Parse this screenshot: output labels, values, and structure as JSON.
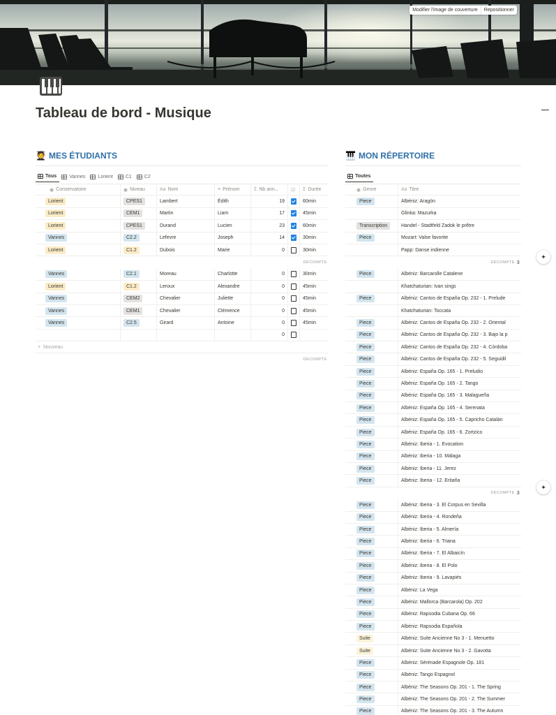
{
  "cover": {
    "change_label": "Modifier l'image de couverture",
    "reposition_label": "Repositionner"
  },
  "page": {
    "icon": "piano-keys-icon",
    "title": "Tableau de bord - Musique"
  },
  "students": {
    "emoji": "🧑‍🎓",
    "title": "MES ÉTUDIANTS",
    "tabs": [
      "Tous",
      "Vannes",
      "Lorient",
      "C1",
      "C2"
    ],
    "columns": [
      "Conservatoire",
      "Niveau",
      "Nom",
      "Prénom",
      "Nb ann...",
      "",
      "Durée"
    ],
    "groups": [
      {
        "rows": [
          {
            "conservatoire": "Lorient",
            "niveau": "CPES1",
            "nom": "Lambert",
            "prenom": "Édith",
            "nb": "19",
            "checked": true,
            "duree": "60min"
          },
          {
            "conservatoire": "Lorient",
            "niveau": "CEM1",
            "nom": "Martin",
            "prenom": "Liam",
            "nb": "17",
            "checked": true,
            "duree": "45min"
          },
          {
            "conservatoire": "Lorient",
            "niveau": "CPES1",
            "nom": "Durand",
            "prenom": "Lucien",
            "nb": "23",
            "checked": true,
            "duree": "60min"
          },
          {
            "conservatoire": "Vannes",
            "niveau": "C2.2",
            "nom": "Lefevre",
            "prenom": "Joseph",
            "nb": "14",
            "checked": true,
            "duree": "30min"
          },
          {
            "conservatoire": "Lorient",
            "niveau": "C1.2",
            "nom": "Dubois",
            "prenom": "Marie",
            "nb": "0",
            "checked": false,
            "duree": "30min"
          }
        ],
        "count_label": "DÉCOMPTE",
        "count_value": ""
      },
      {
        "rows": [
          {
            "conservatoire": "Vannes",
            "niveau": "C2.1",
            "nom": "Moreau",
            "prenom": "Charlotte",
            "nb": "0",
            "checked": false,
            "duree": "30min"
          },
          {
            "conservatoire": "Lorient",
            "niveau": "C1.2",
            "nom": "Leroux",
            "prenom": "Alexandre",
            "nb": "0",
            "checked": false,
            "duree": "45min"
          },
          {
            "conservatoire": "Vannes",
            "niveau": "CEM2",
            "nom": "Chevalier",
            "prenom": "Juliette",
            "nb": "0",
            "checked": false,
            "duree": "45min"
          },
          {
            "conservatoire": "Vannes",
            "niveau": "CEM1",
            "nom": "Chevalier",
            "prenom": "Clémence",
            "nb": "0",
            "checked": false,
            "duree": "45min"
          },
          {
            "conservatoire": "Vannes",
            "niveau": "C2.5",
            "nom": "Girard",
            "prenom": "Antoine",
            "nb": "0",
            "checked": false,
            "duree": "45min"
          },
          {
            "conservatoire": "",
            "niveau": "",
            "nom": "",
            "prenom": "",
            "nb": "0",
            "checked": false,
            "duree": ""
          }
        ],
        "new_label": "Nouveau",
        "count_label": "DÉCOMPTE",
        "count_value": ""
      }
    ]
  },
  "repertoire": {
    "emoji": "🎹",
    "title": "MON RÉPERTOIRE",
    "tabs": [
      "Toutes"
    ],
    "columns": [
      "Genre",
      "Titre"
    ],
    "groups": [
      {
        "rows": [
          {
            "genre": "Piece",
            "titre": "Albéniz: Aragòn"
          },
          {
            "genre": "",
            "titre": "Glinka: Mazurka"
          },
          {
            "genre": "Transcription",
            "titre": "Handel - Stadtfeld Zadok le prêtre"
          },
          {
            "genre": "Piece",
            "titre": "Mozart: Valse favorite"
          },
          {
            "genre": "",
            "titre": "Papp: Danse indienne"
          }
        ],
        "count_label": "DÉCOMPTE",
        "count_value": "3"
      },
      {
        "rows": [
          {
            "genre": "Piece",
            "titre": "Albéniz: Barcarolle Catalene"
          },
          {
            "genre": "",
            "titre": "Khatchaturian: Ivan sings"
          },
          {
            "genre": "Piece",
            "titre": "Albéniz: Cantos de España Op. 232 - 1. Prelude"
          },
          {
            "genre": "",
            "titre": "Khatchaturian: Toccata"
          },
          {
            "genre": "Piece",
            "titre": "Albéniz: Cantos de España Op. 232 - 2. Oriental"
          },
          {
            "genre": "Piece",
            "titre": "Albéniz: Cantos de España Op. 232 - 3. Bajo la p"
          },
          {
            "genre": "Piece",
            "titre": "Albéniz: Cantos de España Op. 232 - 4. Córdoba"
          },
          {
            "genre": "Piece",
            "titre": "Albéniz: Cantos de España Op. 232 - 5. Seguidil"
          },
          {
            "genre": "Piece",
            "titre": "Albéniz: España Op. 165 - 1. Preludio"
          },
          {
            "genre": "Piece",
            "titre": "Albéniz: España Op. 165 - 2. Tango"
          },
          {
            "genre": "Piece",
            "titre": "Albéniz: España Op. 165 - 3. Malagueña"
          },
          {
            "genre": "Piece",
            "titre": "Albéniz: España Op. 165 - 4. Serenata"
          },
          {
            "genre": "Piece",
            "titre": "Albéniz: España Op. 165 - 5. Capricho Catalán"
          },
          {
            "genre": "Piece",
            "titre": "Albéniz: España Op. 165 - 6. Zortzico"
          },
          {
            "genre": "Piece",
            "titre": "Albéniz: Iberia - 1. Evocation"
          },
          {
            "genre": "Piece",
            "titre": "Albéniz: Iberia - 10. Málaga"
          },
          {
            "genre": "Piece",
            "titre": "Albéniz: Iberia - 11. Jerez"
          },
          {
            "genre": "Piece",
            "titre": "Albéniz: Iberia - 12. Eritaña"
          }
        ],
        "count_label": "DÉCOMPTE",
        "count_value": "3"
      },
      {
        "rows": [
          {
            "genre": "Piece",
            "titre": "Albéniz: Iberia - 3. El Corpus en Sevilla"
          },
          {
            "genre": "Piece",
            "titre": "Albéniz: Iberia - 4. Rondeña"
          },
          {
            "genre": "Piece",
            "titre": "Albéniz: Iberia - 5. Almería"
          },
          {
            "genre": "Piece",
            "titre": "Albéniz: Iberia - 6. Triana"
          },
          {
            "genre": "Piece",
            "titre": "Albéniz: Iberia - 7. El Albaicín"
          },
          {
            "genre": "Piece",
            "titre": "Albéniz: Iberia - 8. El Polo"
          },
          {
            "genre": "Piece",
            "titre": "Albéniz: Iberia - 9. Lavapiés"
          },
          {
            "genre": "Piece",
            "titre": "Albéniz: La Vega"
          },
          {
            "genre": "Piece",
            "titre": "Albéniz: Mallorca (Barcarola) Op. 202"
          },
          {
            "genre": "Piece",
            "titre": "Albéniz: Rapsodia Cubana Op. 66"
          },
          {
            "genre": "Piece",
            "titre": "Albéniz: Rapsodia Española"
          },
          {
            "genre": "Suite",
            "titre": "Albéniz: Suite Ancienne No 3 - 1. Menuetto"
          },
          {
            "genre": "Suite",
            "titre": "Albéniz: Suite Ancienne No 3 - 2. Gavotta"
          },
          {
            "genre": "Piece",
            "titre": "Albéniz: Sérénade Espagnole Op. 181"
          },
          {
            "genre": "Piece",
            "titre": "Albéniz: Tango Espagnol"
          },
          {
            "genre": "Piece",
            "titre": "Albéniz: The Seasons Op. 201 - 1. The Spring"
          },
          {
            "genre": "Piece",
            "titre": "Albéniz: The Seasons Op. 201 - 2. The Summer"
          },
          {
            "genre": "Piece",
            "titre": "Albéniz: The Seasons Op. 201 - 3. The Autumn"
          }
        ]
      }
    ]
  },
  "colors": {
    "tag_lorient": "#fbecc7",
    "tag_vannes": "#d3e5ef",
    "tag_gray": "#e3e2e0",
    "tag_yellow": "#fdecc8",
    "tag_blue": "#d3e5ef",
    "tag_suite": "#fbf3db",
    "accent_blue": "#2f6fa7",
    "checkbox_on": "#2383e2"
  }
}
